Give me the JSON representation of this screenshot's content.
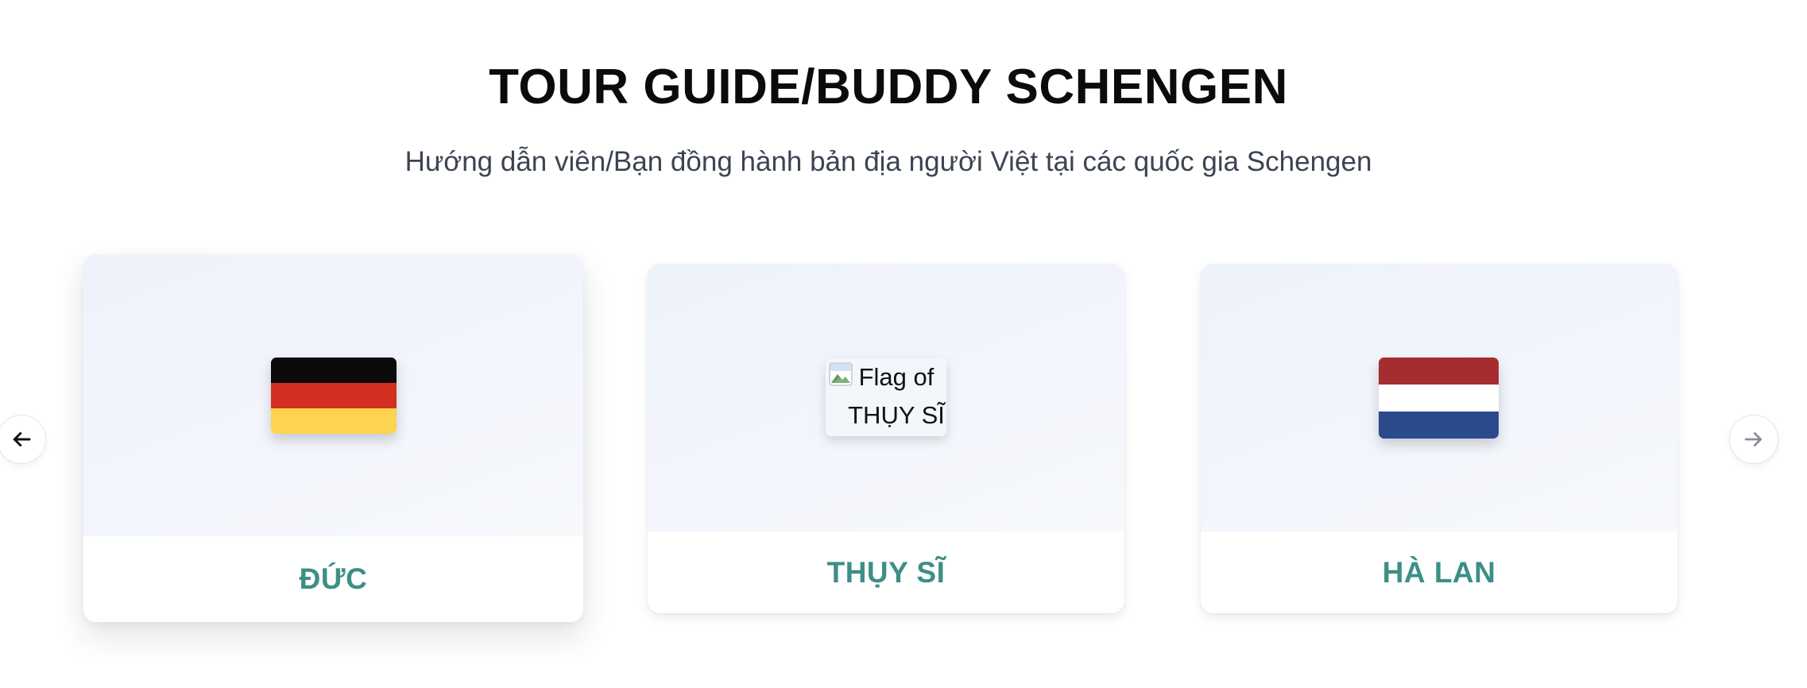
{
  "header": {
    "title": "TOUR GUIDE/BUDDY SCHENGEN",
    "subtitle": "Hướng dẫn viên/Bạn đồng hành bản địa người Việt tại các quốc gia Schengen"
  },
  "carousel": {
    "prev_icon": "arrow-left-icon",
    "next_icon": "arrow-right-icon",
    "cards": [
      {
        "label": "ĐỨC",
        "flag": "germany-flag"
      },
      {
        "label": "THỤY SĨ",
        "flag_alt": "Flag of THỤY SĨ"
      },
      {
        "label": "HÀ LAN",
        "flag": "netherlands-flag"
      }
    ]
  },
  "colors": {
    "label": "#3d8f86",
    "card_top": "#eef2fb",
    "title": "#0b0b0b",
    "subtitle": "#3b4452"
  }
}
